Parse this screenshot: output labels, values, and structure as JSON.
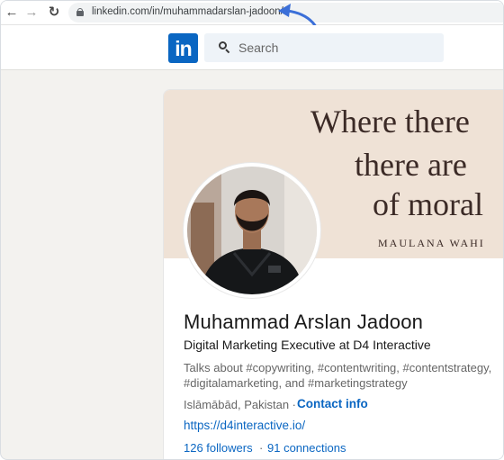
{
  "browser": {
    "back_icon": "arrow-left-icon",
    "forward_icon": "arrow-right-icon",
    "reload_icon": "reload-icon",
    "url_domain": "linkedin.com",
    "url_path": "/in/muhammadarslan-jadoon/"
  },
  "linkedin": {
    "logo_text": "in",
    "brand_color": "#0a66c2",
    "search_placeholder": "Search"
  },
  "profile": {
    "banner_lines": [
      "Where there",
      "there are",
      "of moral",
      "MAULANA WAHI"
    ],
    "name": "Muhammad Arslan Jadoon",
    "headline": "Digital Marketing Executive at D4 Interactive",
    "about_line1": "Talks about #copywriting, #contentwriting, #contentstrategy,",
    "about_line2": "#digitalamarketing, and #marketingstrategy",
    "location": "Islāmābād, Pakistan ·",
    "contact_info": "Contact info",
    "website": "https://d4interactive.io/",
    "followers": "126 followers",
    "separator": "·",
    "connections": "91 connections"
  }
}
